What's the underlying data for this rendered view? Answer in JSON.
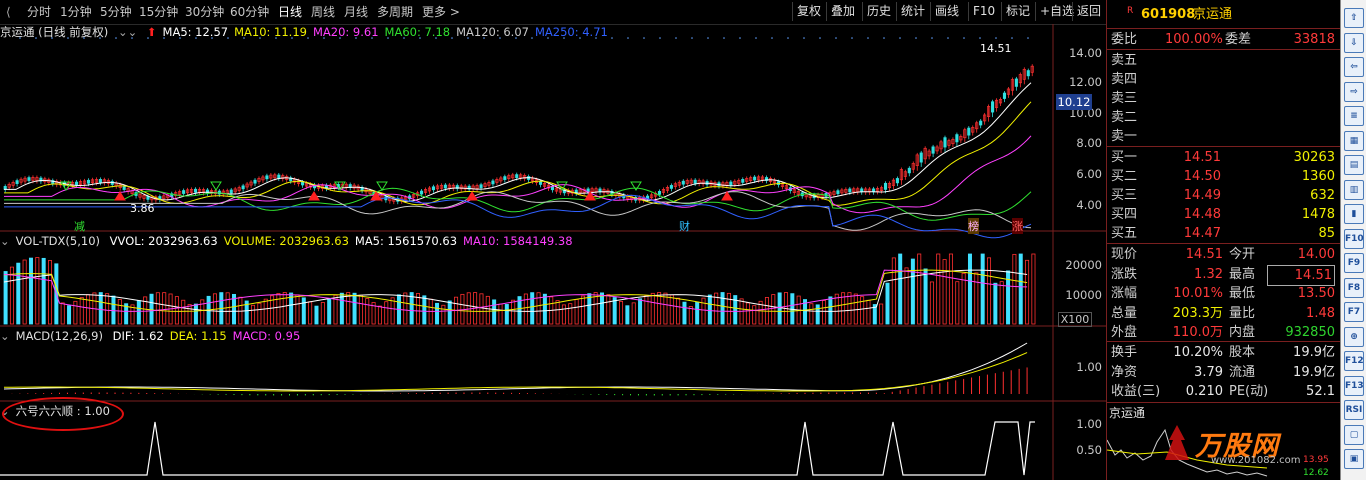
{
  "toolbar": {
    "periods": [
      "分时",
      "1分钟",
      "5分钟",
      "15分钟",
      "30分钟",
      "60分钟",
      "日线",
      "周线",
      "月线",
      "多周期",
      "更多 >"
    ],
    "active_period": "日线",
    "buttons": [
      "复权",
      "叠加",
      "历史",
      "统计",
      "画线",
      "F10",
      "标记",
      "+自选",
      "返回"
    ]
  },
  "main_chart": {
    "title": "京运通 (日线 前复权)",
    "ma": [
      {
        "label": "MA5: 12.57",
        "color": "#ffffff"
      },
      {
        "label": "MA10: 11.19",
        "color": "#f0f000"
      },
      {
        "label": "MA20: 9.61",
        "color": "#ff40ff"
      },
      {
        "label": "MA60: 7.18",
        "color": "#30e030"
      },
      {
        "label": "MA120: 6.07",
        "color": "#c8c8c8"
      },
      {
        "label": "MA250: 4.71",
        "color": "#3060ff"
      }
    ],
    "y_ticks": [
      "14.00",
      "12.00",
      "10.00",
      "8.00",
      "6.00",
      "4.00"
    ],
    "price_tag": "10.12",
    "high_label": "14.51",
    "low_label": "3.86",
    "markers": [
      "减",
      "财",
      "榜",
      "涨"
    ]
  },
  "vol_chart": {
    "title": "VOL-TDX(5,10)",
    "values": [
      {
        "label": "VVOL: 2032963.63",
        "color": "#ffffff"
      },
      {
        "label": "VOLUME: 2032963.63",
        "color": "#f0f000"
      },
      {
        "label": "MA5: 1561570.63",
        "color": "#ffffff"
      },
      {
        "label": "MA10: 1584149.38",
        "color": "#ff40ff"
      }
    ],
    "y_ticks": [
      "20000",
      "10000"
    ],
    "unit": "X100"
  },
  "macd_chart": {
    "title": "MACD(12,26,9)",
    "values": [
      {
        "label": "DIF: 1.62",
        "color": "#ffffff"
      },
      {
        "label": "DEA: 1.15",
        "color": "#f0f000"
      },
      {
        "label": "MACD: 0.95",
        "color": "#ff40ff"
      }
    ],
    "y_ticks": [
      "1.00"
    ]
  },
  "signal_chart": {
    "title": "六号六六顺 : 1.00",
    "y_ticks": [
      "1.00",
      "0.50"
    ]
  },
  "panel": {
    "code": "601908",
    "name": "京运通",
    "weibi": {
      "label": "委比",
      "value": "100.00%",
      "label2": "委差",
      "value2": "33818"
    },
    "sell": [
      {
        "label": "卖五",
        "price": "",
        "vol": ""
      },
      {
        "label": "卖四",
        "price": "",
        "vol": ""
      },
      {
        "label": "卖三",
        "price": "",
        "vol": ""
      },
      {
        "label": "卖二",
        "price": "",
        "vol": ""
      },
      {
        "label": "卖一",
        "price": "",
        "vol": ""
      }
    ],
    "buy": [
      {
        "label": "买一",
        "price": "14.51",
        "vol": "30263"
      },
      {
        "label": "买二",
        "price": "14.50",
        "vol": "1360"
      },
      {
        "label": "买三",
        "price": "14.49",
        "vol": "632"
      },
      {
        "label": "买四",
        "price": "14.48",
        "vol": "1478"
      },
      {
        "label": "买五",
        "price": "14.47",
        "vol": "85"
      }
    ],
    "stats1": [
      {
        "l1": "现价",
        "v1": "14.51",
        "c1": "red",
        "l2": "今开",
        "v2": "14.00",
        "c2": "red"
      },
      {
        "l1": "涨跌",
        "v1": "1.32",
        "c1": "red",
        "l2": "最高",
        "v2": "14.51",
        "c2": "red"
      },
      {
        "l1": "涨幅",
        "v1": "10.01%",
        "c1": "red",
        "l2": "最低",
        "v2": "13.50",
        "c2": "red"
      },
      {
        "l1": "总量",
        "v1": "203.3万",
        "c1": "yellow",
        "l2": "量比",
        "v2": "1.48",
        "c2": "red"
      },
      {
        "l1": "外盘",
        "v1": "110.0万",
        "c1": "red",
        "l2": "内盘",
        "v2": "932850",
        "c2": "green"
      }
    ],
    "stats2": [
      {
        "l1": "换手",
        "v1": "10.20%",
        "c1": "white",
        "l2": "股本",
        "v2": "19.9亿",
        "c2": "white"
      },
      {
        "l1": "净资",
        "v1": "3.79",
        "c1": "white",
        "l2": "流通",
        "v2": "19.9亿",
        "c2": "white"
      },
      {
        "l1": "收益(三)",
        "v1": "0.210",
        "c1": "white",
        "l2": "PE(动)",
        "v2": "52.1",
        "c2": "white"
      }
    ],
    "mini_title": "京运通",
    "watermark": "万股网",
    "watermark_url": "www.201082.com",
    "mini_prices": [
      "13.95",
      "12.62"
    ]
  },
  "sidebar": {
    "icons": [
      "up-arrow-icon",
      "down-arrow-icon",
      "left-arrow-icon",
      "right-arrow-icon",
      "list-icon",
      "grid-icon",
      "table-icon",
      "candlestick-icon",
      "bar-chart-icon",
      "f10-icon",
      "f9-icon",
      "f8-icon",
      "f7-icon",
      "zoom-icon",
      "f12-icon",
      "f13-icon",
      "rsi-icon",
      "window-icon",
      "window2-icon"
    ],
    "labels": [
      "",
      "",
      "",
      "",
      "",
      "",
      "",
      "",
      "",
      "F10",
      "F9",
      "F8",
      "F7",
      "",
      "F12",
      "F13",
      "RSI",
      "",
      ""
    ]
  }
}
